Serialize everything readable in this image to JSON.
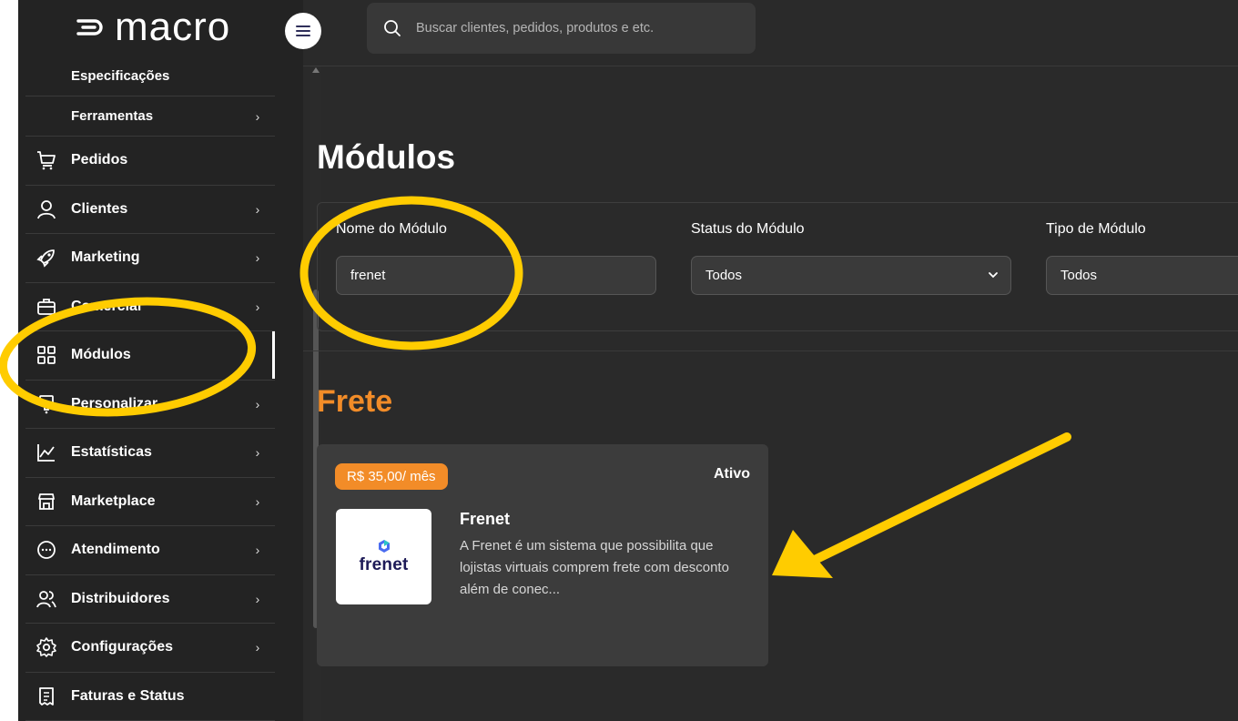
{
  "app": {
    "logo_text": "macro"
  },
  "search": {
    "placeholder": "Buscar clientes, pedidos, produtos e etc."
  },
  "sidebar": {
    "items": [
      {
        "label": "Especificações",
        "icon": "none",
        "submenu": false,
        "sub": true
      },
      {
        "label": "Ferramentas",
        "icon": "none",
        "submenu": true,
        "sub": true
      },
      {
        "label": "Pedidos",
        "icon": "cart-icon",
        "submenu": false
      },
      {
        "label": "Clientes",
        "icon": "user-icon",
        "submenu": true
      },
      {
        "label": "Marketing",
        "icon": "rocket-icon",
        "submenu": true
      },
      {
        "label": "Comercial",
        "icon": "briefcase-icon",
        "submenu": true
      },
      {
        "label": "Módulos",
        "icon": "grid-icon",
        "submenu": false,
        "active": true
      },
      {
        "label": "Personalizar",
        "icon": "brush-icon",
        "submenu": true
      },
      {
        "label": "Estatísticas",
        "icon": "chart-icon",
        "submenu": true
      },
      {
        "label": "Marketplace",
        "icon": "store-icon",
        "submenu": true
      },
      {
        "label": "Atendimento",
        "icon": "chat-icon",
        "submenu": true
      },
      {
        "label": "Distribuidores",
        "icon": "users-icon",
        "submenu": true
      },
      {
        "label": "Configurações",
        "icon": "gear-icon",
        "submenu": true
      },
      {
        "label": "Faturas e Status",
        "icon": "invoice-icon",
        "submenu": false
      }
    ]
  },
  "main": {
    "title": "Módulos",
    "filters": {
      "name_label": "Nome do Módulo",
      "name_value": "frenet",
      "status_label": "Status do Módulo",
      "status_value": "Todos",
      "type_label": "Tipo de Módulo",
      "type_value": "Todos"
    },
    "section_title": "Frete",
    "card": {
      "price": "R$ 35,00/ mês",
      "status": "Ativo",
      "name": "Frenet",
      "description": "A Frenet é um sistema que possibilita que lojistas virtuais comprem frete com desconto além de conec...",
      "logo_text": "frenet"
    }
  },
  "colors": {
    "accent": "#f28c28",
    "annotation": "#ffcc00",
    "background": "#2a2a2a"
  }
}
